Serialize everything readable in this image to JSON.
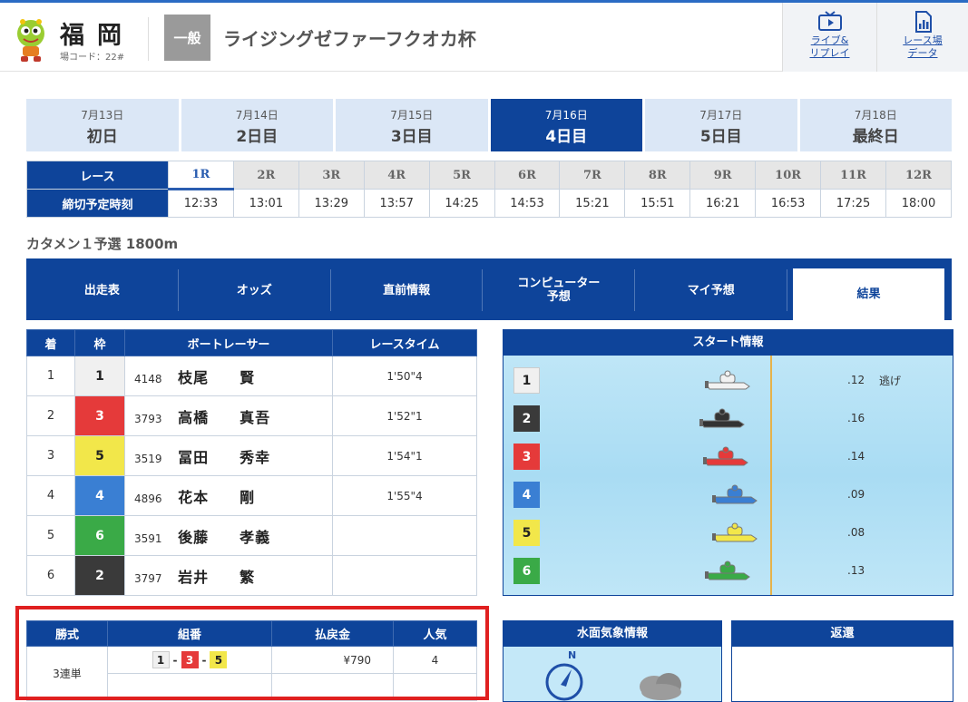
{
  "header": {
    "venue_name": "福岡",
    "venue_code": "場コード：22#",
    "grade": "一般",
    "race_title": "ライジングゼファーフクオカ杯",
    "buttons": [
      {
        "label_1": "ライブ&",
        "label_2": "リプレイ",
        "icon": "tv-play-icon"
      },
      {
        "label_1": "レース場",
        "label_2": "データ",
        "icon": "document-chart-icon"
      }
    ]
  },
  "days": [
    {
      "date": "7月13日",
      "label": "初日",
      "active": false
    },
    {
      "date": "7月14日",
      "label": "2日目",
      "active": false
    },
    {
      "date": "7月15日",
      "label": "3日目",
      "active": false
    },
    {
      "date": "7月16日",
      "label": "4日目",
      "active": true
    },
    {
      "date": "7月17日",
      "label": "5日目",
      "active": false
    },
    {
      "date": "7月18日",
      "label": "最終日",
      "active": false
    }
  ],
  "race_table": {
    "race_header": "レース",
    "time_header": "締切予定時刻",
    "races": [
      {
        "no": "1R",
        "time": "12:33",
        "active": true
      },
      {
        "no": "2R",
        "time": "13:01",
        "active": false
      },
      {
        "no": "3R",
        "time": "13:29",
        "active": false
      },
      {
        "no": "4R",
        "time": "13:57",
        "active": false
      },
      {
        "no": "5R",
        "time": "14:25",
        "active": false
      },
      {
        "no": "6R",
        "time": "14:53",
        "active": false
      },
      {
        "no": "7R",
        "time": "15:21",
        "active": false
      },
      {
        "no": "8R",
        "time": "15:51",
        "active": false
      },
      {
        "no": "9R",
        "time": "16:21",
        "active": false
      },
      {
        "no": "10R",
        "time": "16:53",
        "active": false
      },
      {
        "no": "11R",
        "time": "17:25",
        "active": false
      },
      {
        "no": "12R",
        "time": "18:00",
        "active": false
      }
    ]
  },
  "race_subtitle": "カタメン１予選 1800m",
  "menu": [
    {
      "label": "出走表",
      "label_2": "",
      "active": false
    },
    {
      "label": "オッズ",
      "label_2": "",
      "active": false
    },
    {
      "label": "直前情報",
      "label_2": "",
      "active": false
    },
    {
      "label": "コンピューター",
      "label_2": "予想",
      "active": false
    },
    {
      "label": "マイ予想",
      "label_2": "",
      "active": false
    },
    {
      "label": "結果",
      "label_2": "",
      "active": true
    }
  ],
  "results": {
    "headers": [
      "着",
      "枠",
      "ボートレーサー",
      "レースタイム"
    ],
    "rows": [
      {
        "place": "1",
        "frame": "1",
        "reg": "4148",
        "name": "枝尾　　賢",
        "time": "1'50\"4",
        "color": "#f0f0f0"
      },
      {
        "place": "2",
        "frame": "3",
        "reg": "3793",
        "name": "高橋　　真吾",
        "time": "1'52\"1",
        "color": "#e53a3a"
      },
      {
        "place": "3",
        "frame": "5",
        "reg": "3519",
        "name": "冨田　　秀幸",
        "time": "1'54\"1",
        "color": "#f2e74a"
      },
      {
        "place": "4",
        "frame": "4",
        "reg": "4896",
        "name": "花本　　剛",
        "time": "1'55\"4",
        "color": "#3a7fd3"
      },
      {
        "place": "5",
        "frame": "6",
        "reg": "3591",
        "name": "後藤　　孝義",
        "time": "",
        "color": "#3aaa47"
      },
      {
        "place": "6",
        "frame": "2",
        "reg": "3797",
        "name": "岩井　　繁",
        "time": "",
        "color": "#3a3a3a"
      }
    ]
  },
  "start_info": {
    "title": "スタート情報",
    "rows": [
      {
        "course": "1",
        "timing": ".12",
        "technique": "逃げ",
        "boat_color": "#f2f2f2"
      },
      {
        "course": "2",
        "timing": ".16",
        "technique": "",
        "boat_color": "#333333"
      },
      {
        "course": "3",
        "timing": ".14",
        "technique": "",
        "boat_color": "#e53a3a"
      },
      {
        "course": "4",
        "timing": ".09",
        "technique": "",
        "boat_color": "#3a7fd3"
      },
      {
        "course": "5",
        "timing": ".08",
        "technique": "",
        "boat_color": "#f2e74a"
      },
      {
        "course": "6",
        "timing": ".13",
        "technique": "",
        "boat_color": "#3aaa47"
      }
    ]
  },
  "payout": {
    "headers": [
      "勝式",
      "組番",
      "払戻金",
      "人気"
    ],
    "bet_type": "3連単",
    "combination": [
      "1",
      "3",
      "5"
    ],
    "amount": "¥790",
    "popularity": "4"
  },
  "weather_panel": {
    "title": "水面気象情報",
    "compass_label": "N"
  },
  "refund_panel": {
    "title": "返還"
  }
}
